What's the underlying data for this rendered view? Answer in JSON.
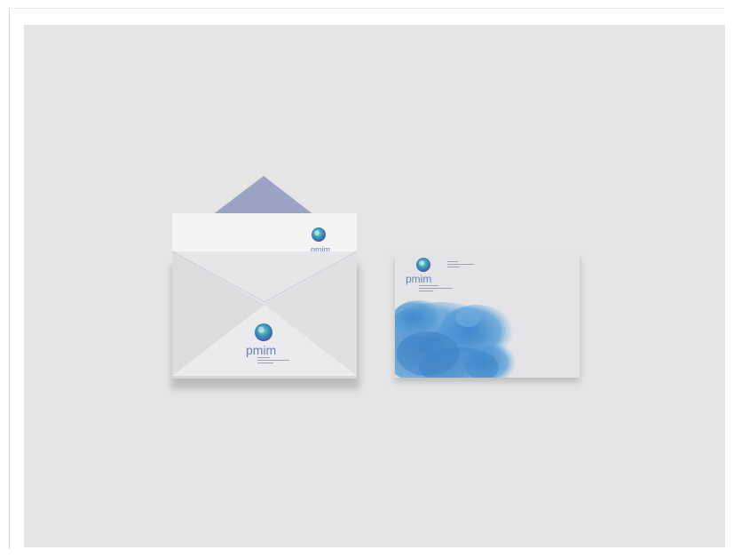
{
  "brand": {
    "logo_text": "pmim",
    "accent_colors": {
      "logo_teal": "#3aa7b3",
      "logo_blue": "#3c6fb6",
      "logo_violet": "#5a4fa6",
      "watercolor": "#4a8fd0",
      "flap_lavender": "#9aa3c3",
      "background": "#e5e5e6"
    }
  },
  "scene": {
    "items": [
      {
        "kind": "open-envelope-with-letter"
      },
      {
        "kind": "envelope-front-with-watercolor"
      }
    ]
  }
}
